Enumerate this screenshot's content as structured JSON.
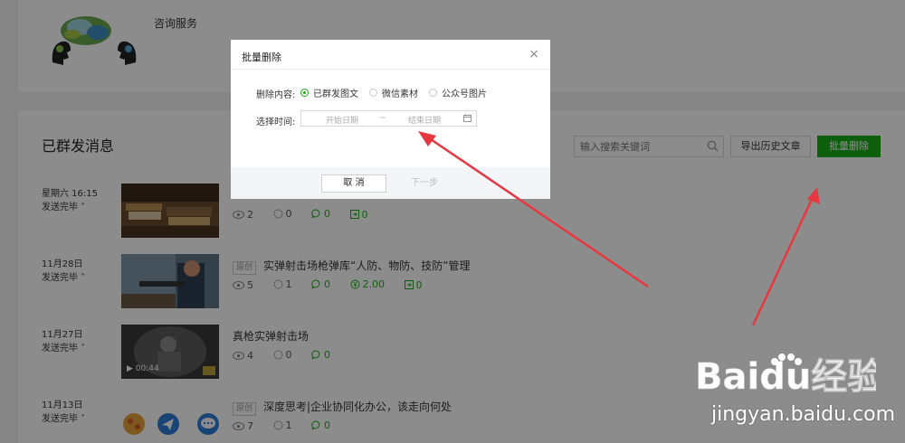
{
  "account": {
    "name": "咨询服务"
  },
  "section": {
    "title": "已群发消息"
  },
  "toolbar": {
    "search_placeholder": "输入搜索关键词",
    "export_label": "导出历史文章",
    "batch_delete_label": "批量删除"
  },
  "rows": [
    {
      "date": "星期六 16:15",
      "status": "发送完毕 ˅",
      "title": "",
      "original": false,
      "stats": {
        "reads": "2",
        "likes": "0",
        "comments": "0",
        "shares": "0",
        "reward": ""
      }
    },
    {
      "date": "11月28日",
      "status": "发送完毕 ˅",
      "title": "实弹射击场枪弹库“人防、物防、技防”管理",
      "original": true,
      "original_label": "原创",
      "stats": {
        "reads": "5",
        "likes": "1",
        "comments": "0",
        "shares": "0",
        "reward": "2.00"
      }
    },
    {
      "date": "11月27日",
      "status": "发送完毕 ˅",
      "title": "真枪实弹射击场",
      "original": false,
      "video_duration": "▶ 00:44",
      "stats": {
        "reads": "4",
        "likes": "0",
        "comments": "0",
        "shares": "",
        "reward": ""
      }
    },
    {
      "date": "11月13日",
      "status": "发送完毕 ˅",
      "title": "深度思考|企业协同化办公，该走向何处",
      "original": true,
      "original_label": "原创",
      "stats": {
        "reads": "7",
        "likes": "1",
        "comments": "0",
        "shares": "",
        "reward": ""
      }
    }
  ],
  "dialog": {
    "title": "批量删除",
    "close": "×",
    "content_label": "删除内容:",
    "options": [
      "已群发图文",
      "微信素材",
      "公众号图片"
    ],
    "selected_option": "已群发图文",
    "time_label": "选择时间:",
    "start_placeholder": "开始日期",
    "separator": "~",
    "end_placeholder": "结束日期",
    "cancel_label": "取 消",
    "next_label": "下一步"
  },
  "watermark": {
    "brand": "Baidu经验",
    "url": "jingyan.baidu.com"
  },
  "colors": {
    "accent": "#1aad19",
    "arrow": "#e8373f",
    "overlay": "rgba(0,0,0,0.45)"
  }
}
